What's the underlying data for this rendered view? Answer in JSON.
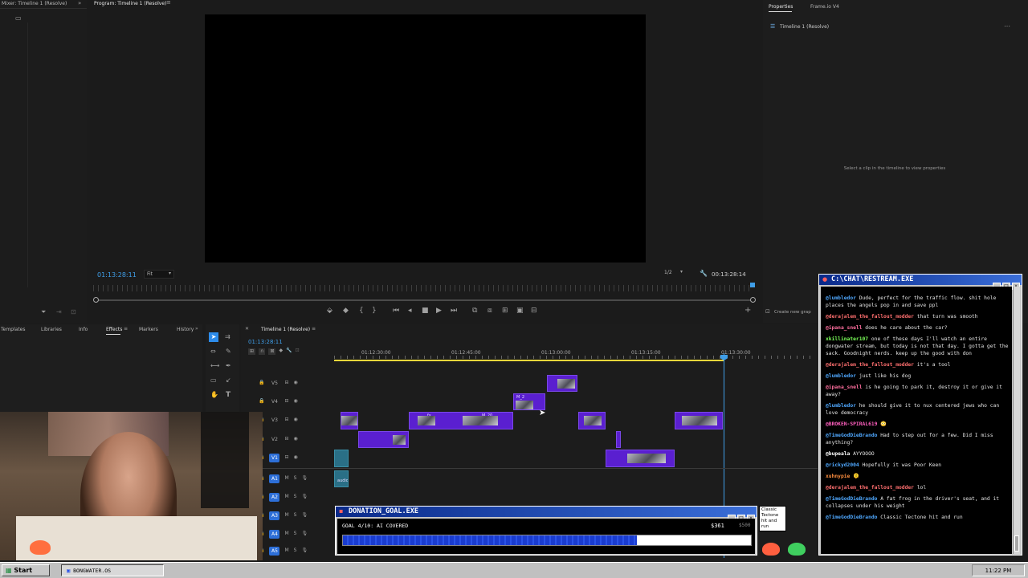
{
  "source_panel": {
    "tab": "Mixer: Timeline 1 (Resolve)"
  },
  "program_monitor": {
    "tab": "Program: Timeline 1 (Resolve)",
    "timecode_current": "01:13:28:11",
    "fit": "Fit",
    "resolution": "1/2",
    "timecode_duration": "00:13:28:14"
  },
  "properties_panel": {
    "tabs": [
      "Properties",
      "Frame.io V4"
    ],
    "sequence_name": "Timeline 1 (Resolve)",
    "empty_message": "Select a clip in the timeline to view properties",
    "cut_label": "Create new grap"
  },
  "effects_panel": {
    "tabs": [
      "Templates",
      "Libraries",
      "Info",
      "Effects",
      "Markers",
      "History"
    ]
  },
  "timeline": {
    "tab": "Timeline 1 (Resolve)",
    "timecode": "01:13:28:11",
    "ruler": [
      "01:12:30:00",
      "01:12:45:00",
      "01:13:00:00",
      "01:13:15:00",
      "01:13:30:00"
    ],
    "video_tracks": [
      "V5",
      "V4",
      "V3",
      "V2",
      "V1"
    ],
    "audio_tracks": [
      "A1",
      "A2",
      "A3",
      "A4",
      "A5"
    ],
    "clip_labels": [
      "M_2",
      "fx",
      "M_20",
      "audio"
    ]
  },
  "chat": {
    "title": "C:\\CHAT\\RESTREAM.EXE",
    "messages": [
      {
        "user": "@lumbledor",
        "text": "Dude, perfect for the traffic flow. shit hole places the angels pop in and save ppl",
        "color": "#4fa8ff"
      },
      {
        "user": "@derajalem_the_fallout_modder",
        "text": "that turn was smooth",
        "color": "#ff6f6f"
      },
      {
        "user": "@ipana_snell",
        "text": "does he care about the car?",
        "color": "#ff6f9f"
      },
      {
        "user": "xkillinater107",
        "text": "one of these days I'll watch an entire dongwater stream, but today is not that day. I gotta get the sack. Goodnight nerds. keep up the good with don",
        "color": "#7cff5a"
      },
      {
        "user": "@derajalem_the_fallout_modder",
        "text": "it's a tool",
        "color": "#ff6f6f"
      },
      {
        "user": "@lumbledor",
        "text": "just like his dog",
        "color": "#4fa8ff"
      },
      {
        "user": "@ipana_snell",
        "text": "is he going to park it, destroy it or give it away?",
        "color": "#ff6f9f"
      },
      {
        "user": "@lumbledor",
        "text": "he should give it to nux centered jews who can love democracy",
        "color": "#4fa8ff"
      },
      {
        "user": "@BROKEN-SPIRAL619",
        "text": "😳",
        "color": "#ff5fbf"
      },
      {
        "user": "@TimeGodDieBrando",
        "text": "Had to step out for a few. Did I miss anything?",
        "color": "#4fa8ff"
      },
      {
        "user": "@bupeala",
        "text": "AYYOOOO",
        "color": "#ffffff"
      },
      {
        "user": "@rickyd2004",
        "text": "Hopefully it was Poor Keen",
        "color": "#4fa8ff"
      },
      {
        "user": "xuhnypie",
        "text": "🫠",
        "color": "#ff8f3f"
      },
      {
        "user": "@derajalem_the_fallout_modder",
        "text": "lol",
        "color": "#ff6f6f"
      },
      {
        "user": "@TimeGodDieBrando",
        "text": "A fat frog in the driver's seat, and it collapses under his weight",
        "color": "#4fa8ff"
      },
      {
        "user": "@TimeGodDieBrando",
        "text": "Classic Tectone hit and run",
        "color": "#4fa8ff"
      }
    ]
  },
  "donation": {
    "title": "DONATION_GOAL.EXE",
    "goal_text": "GOAL 4/10: AI COVERED",
    "current": "$361",
    "target": "$500",
    "progress": 0.72,
    "tooltip": "Classic Tectone hit and run"
  },
  "taskbar": {
    "start": "Start",
    "task": "BONGWATER.OS",
    "clock": "11:22 PM"
  },
  "colors": {
    "accent_blue": "#2d8ceb",
    "clip_purple": "#5a1fd0",
    "retro_title": "#0a2a8a",
    "playhead": "#3f9ee8"
  }
}
